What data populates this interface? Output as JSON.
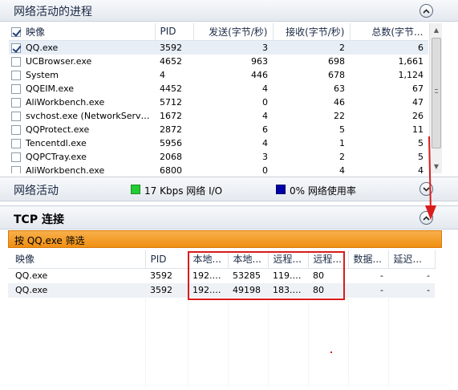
{
  "processes": {
    "title": "网络活动的进程",
    "columns": [
      "映像",
      "PID",
      "发送(字节/秒)",
      "接收(字节/秒)",
      "总数(字节..."
    ],
    "rows": [
      {
        "name": "QQ.exe",
        "pid": "3592",
        "send": "3",
        "recv": "2",
        "total": "6",
        "checked": true
      },
      {
        "name": "UCBrowser.exe",
        "pid": "4652",
        "send": "963",
        "recv": "698",
        "total": "1,661",
        "checked": false
      },
      {
        "name": "System",
        "pid": "4",
        "send": "446",
        "recv": "678",
        "total": "1,124",
        "checked": false
      },
      {
        "name": "QQEIM.exe",
        "pid": "4452",
        "send": "4",
        "recv": "63",
        "total": "67",
        "checked": false
      },
      {
        "name": "AliWorkbench.exe",
        "pid": "5712",
        "send": "0",
        "recv": "46",
        "total": "47",
        "checked": false
      },
      {
        "name": "svchost.exe (NetworkService)",
        "pid": "1672",
        "send": "4",
        "recv": "22",
        "total": "26",
        "checked": false
      },
      {
        "name": "QQProtect.exe",
        "pid": "2872",
        "send": "6",
        "recv": "5",
        "total": "11",
        "checked": false
      },
      {
        "name": "Tencentdl.exe",
        "pid": "5956",
        "send": "4",
        "recv": "1",
        "total": "5",
        "checked": false
      },
      {
        "name": "QQPCTray.exe",
        "pid": "2068",
        "send": "3",
        "recv": "2",
        "total": "5",
        "checked": false
      },
      {
        "name": "AliWorkbench.exe",
        "pid": "6800",
        "send": "0",
        "recv": "4",
        "total": "4",
        "checked": false
      }
    ]
  },
  "network": {
    "title": "网络活动",
    "io_label": "17 Kbps 网络 I/O",
    "usage_label": "0% 网络使用率",
    "io_color": "#22cc33",
    "usage_color": "#0000a8"
  },
  "tcp": {
    "title": "TCP 连接",
    "filter_label": "按 QQ.exe 筛选",
    "columns": [
      "映像",
      "PID",
      "本地...",
      "本地...",
      "远程...",
      "远程...",
      "数据...",
      "延迟..."
    ],
    "rows": [
      {
        "name": "QQ.exe",
        "pid": "3592",
        "local_addr": "192.1...",
        "local_port": "53285",
        "remote_addr": "119.1...",
        "remote_port": "80",
        "data": "-",
        "latency": "-"
      },
      {
        "name": "QQ.exe",
        "pid": "3592",
        "local_addr": "192.1...",
        "local_port": "49198",
        "remote_addr": "183.6...",
        "remote_port": "80",
        "data": "-",
        "latency": "-"
      }
    ]
  },
  "colors": {
    "filter_bar": "#f39a1e",
    "highlight": "#d91c1c"
  }
}
